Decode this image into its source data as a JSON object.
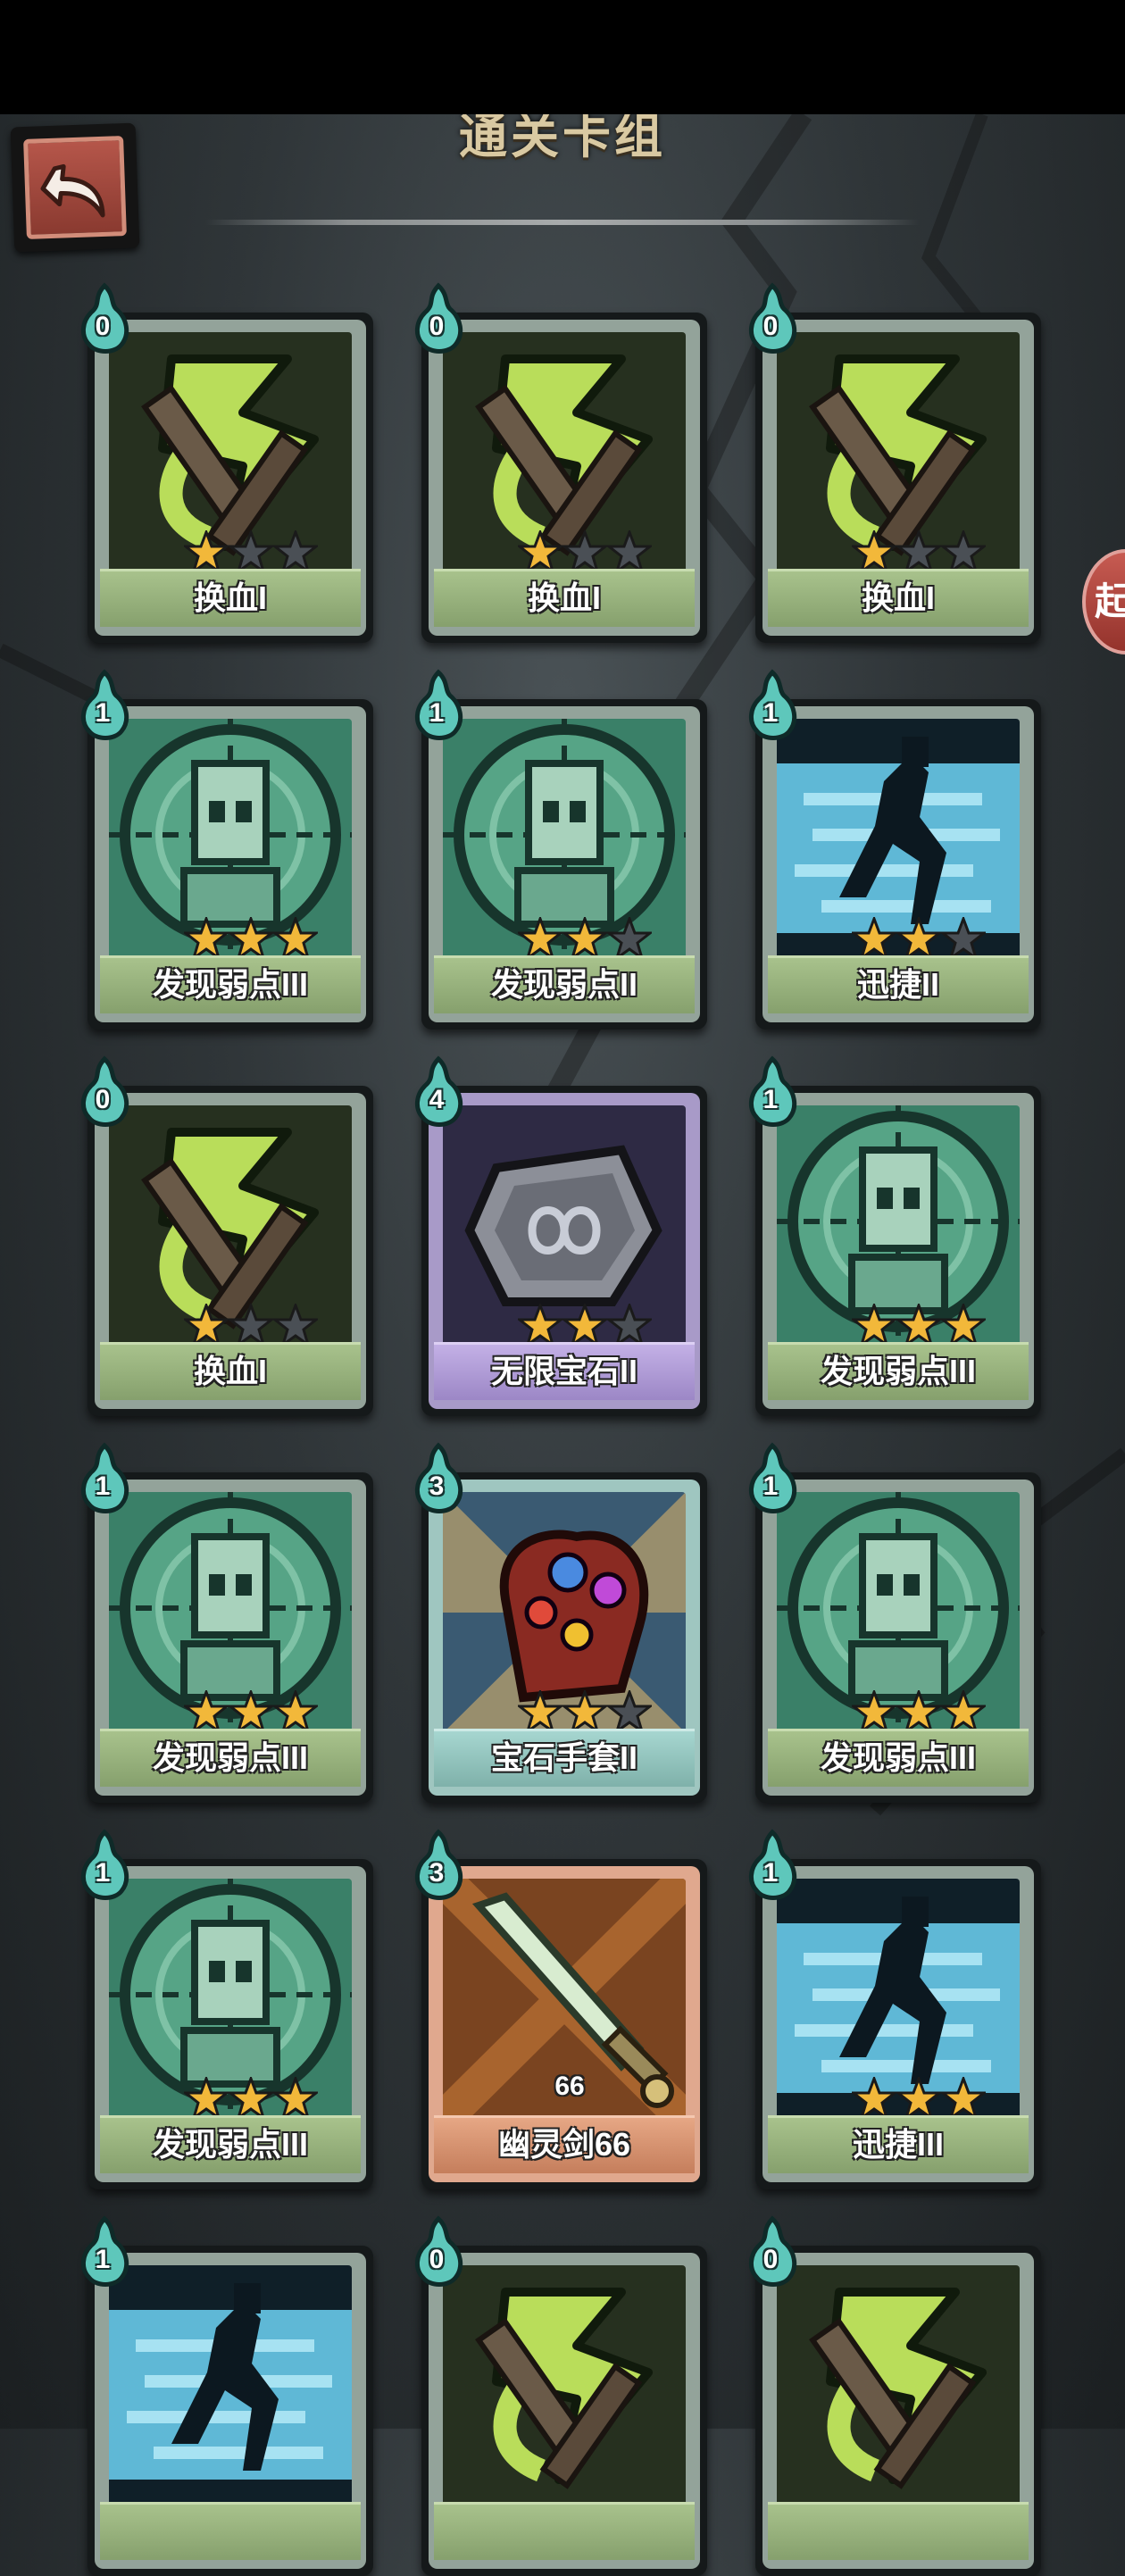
{
  "header": {
    "title": "通关卡组"
  },
  "side_button": {
    "text": "起"
  },
  "colors": {
    "star_on": "#f2b83a",
    "star_off": "#4a4f55",
    "cost_badge": "#5ec7bb"
  },
  "cards": [
    {
      "name": "换血I",
      "cost": "0",
      "stars": 1,
      "art": "blood-swap",
      "rarity": "common"
    },
    {
      "name": "换血I",
      "cost": "0",
      "stars": 1,
      "art": "blood-swap",
      "rarity": "common"
    },
    {
      "name": "换血I",
      "cost": "0",
      "stars": 1,
      "art": "blood-swap",
      "rarity": "common"
    },
    {
      "name": "发现弱点III",
      "cost": "1",
      "stars": 3,
      "art": "weak-point",
      "rarity": "common"
    },
    {
      "name": "发现弱点II",
      "cost": "1",
      "stars": 2,
      "art": "weak-point",
      "rarity": "common"
    },
    {
      "name": "迅捷II",
      "cost": "1",
      "stars": 2,
      "art": "swift",
      "rarity": "common"
    },
    {
      "name": "换血I",
      "cost": "0",
      "stars": 1,
      "art": "blood-swap",
      "rarity": "common"
    },
    {
      "name": "无限宝石II",
      "cost": "4",
      "stars": 2,
      "art": "infinity-gem",
      "rarity": "purple"
    },
    {
      "name": "发现弱点III",
      "cost": "1",
      "stars": 3,
      "art": "weak-point",
      "rarity": "common"
    },
    {
      "name": "发现弱点III",
      "cost": "1",
      "stars": 3,
      "art": "weak-point",
      "rarity": "common"
    },
    {
      "name": "宝石手套II",
      "cost": "3",
      "stars": 2,
      "art": "gem-gauntlet",
      "rarity": "teal"
    },
    {
      "name": "发现弱点III",
      "cost": "1",
      "stars": 3,
      "art": "weak-point",
      "rarity": "common"
    },
    {
      "name": "发现弱点III",
      "cost": "1",
      "stars": 3,
      "art": "weak-point",
      "rarity": "common"
    },
    {
      "name": "幽灵剑66",
      "cost": "3",
      "stars": 0,
      "art": "ghost-sword",
      "rarity": "orange",
      "art_value": "66"
    },
    {
      "name": "迅捷III",
      "cost": "1",
      "stars": 3,
      "art": "swift",
      "rarity": "common"
    },
    {
      "name": "",
      "cost": "1",
      "stars": 0,
      "art": "swift",
      "rarity": "common"
    },
    {
      "name": "",
      "cost": "0",
      "stars": 0,
      "art": "blood-swap",
      "rarity": "common"
    },
    {
      "name": "",
      "cost": "0",
      "stars": 0,
      "art": "blood-swap",
      "rarity": "common"
    }
  ]
}
